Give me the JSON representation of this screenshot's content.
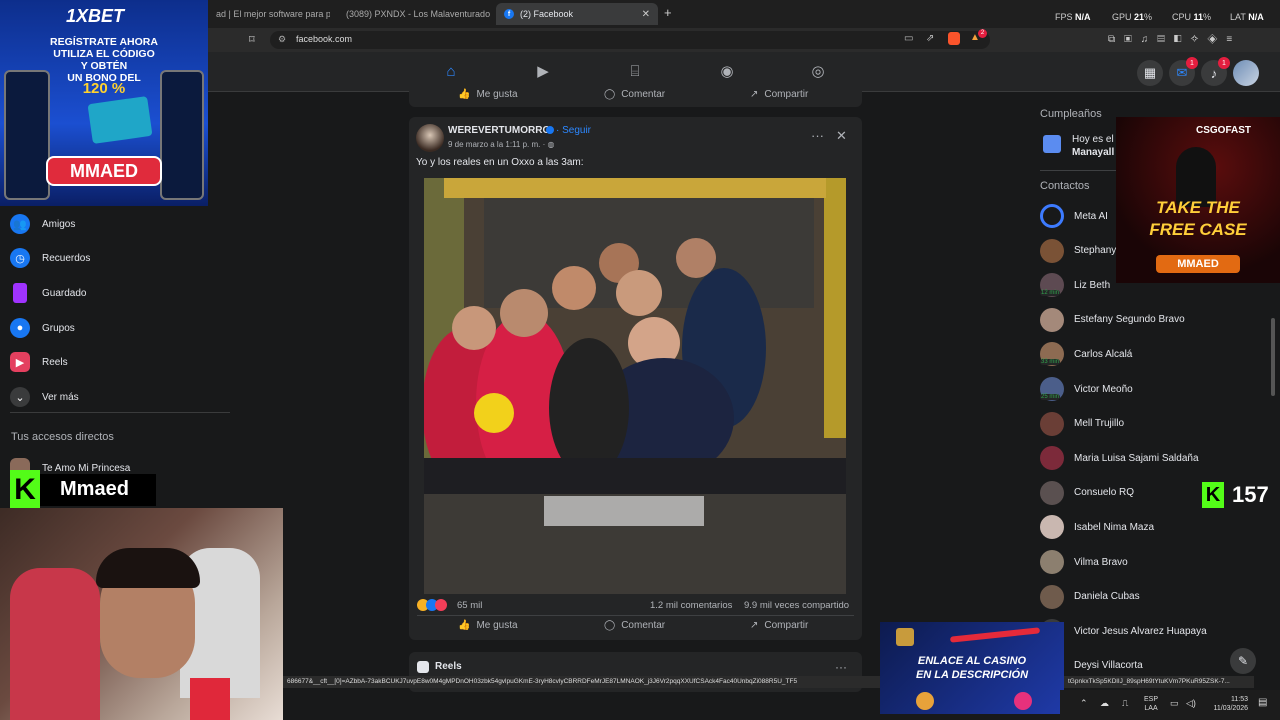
{
  "browser": {
    "tabs": [
      {
        "title": "ad | El mejor software para pote"
      },
      {
        "title": "(3089) PXNDX - Los Malaventurados"
      },
      {
        "title": "(2) Facebook"
      }
    ],
    "new_tab": "+",
    "url": "facebook.com",
    "perf": {
      "fps_label": "FPS",
      "fps": "N/A",
      "gpu_label": "GPU",
      "gpu": "21",
      "gpu_unit": "%",
      "cpu_label": "CPU",
      "cpu": "11",
      "cpu_unit": "%",
      "lat_label": "LAT",
      "lat": "N/A"
    },
    "brave_badge": "2"
  },
  "fb_header": {
    "messenger_badge": "1",
    "notif_badge": "1"
  },
  "left_sidebar": {
    "items": [
      {
        "label": "Amigos",
        "icon": "friends-icon",
        "color": "#1877f2"
      },
      {
        "label": "Recuerdos",
        "icon": "clock-icon",
        "color": "#1877f2"
      },
      {
        "label": "Guardado",
        "icon": "bookmark-icon",
        "color": "#a033ff"
      },
      {
        "label": "Grupos",
        "icon": "groups-icon",
        "color": "#1877f2"
      },
      {
        "label": "Reels",
        "icon": "reels-icon",
        "color": "#e4405f"
      },
      {
        "label": "Ver más",
        "icon": "chevron-down-icon",
        "color": "#3a3b3c"
      }
    ],
    "shortcuts_title": "Tus accesos directos",
    "shortcut": "Te Amo Mi Princesa"
  },
  "feed": {
    "top_actions": {
      "like": "Me gusta",
      "comment": "Comentar",
      "share": "Compartir"
    },
    "post": {
      "author": "WEREVERTUMORRO",
      "follow": "Seguir",
      "date": "9 de marzo a la 1:11 p. m. ·",
      "caption": "Yo y los reales en un Oxxo a las 3am:",
      "reactions": "65 mil",
      "comments": "1.2 mil comentarios",
      "shares": "9.9 mil veces compartido",
      "like": "Me gusta",
      "comment": "Comentar",
      "share": "Compartir"
    },
    "reels_label": "Reels"
  },
  "right_sidebar": {
    "birthdays_title": "Cumpleaños",
    "birthday_text": "Hoy es el",
    "birthday_name": "Manayall",
    "contacts_title": "Contactos",
    "contacts": [
      {
        "name": "Meta AI",
        "color": "#3d7bff",
        "mins": ""
      },
      {
        "name": "Stephany",
        "color": "#7a5236",
        "mins": ""
      },
      {
        "name": "Liz Beth",
        "color": "#5d4a52",
        "mins": "12 min"
      },
      {
        "name": "Estefany Segundo Bravo",
        "color": "#a4897a",
        "mins": ""
      },
      {
        "name": "Carlos Alcalá",
        "color": "#8d6b52",
        "mins": "33 min"
      },
      {
        "name": "Victor Meoño",
        "color": "#4b5e8a",
        "mins": "25 min"
      },
      {
        "name": "Mell Trujillo",
        "color": "#6a3e36",
        "mins": ""
      },
      {
        "name": "Maria Luisa Sajami Saldaña",
        "color": "#7c2a3a",
        "mins": ""
      },
      {
        "name": "Consuelo RQ",
        "color": "#5a5050",
        "mins": ""
      },
      {
        "name": "Isabel Nima Maza",
        "color": "#c9b7b0",
        "mins": ""
      },
      {
        "name": "Vilma Bravo",
        "color": "#8c7f6f",
        "mins": ""
      },
      {
        "name": "Daniela Cubas",
        "color": "#6f5b4c",
        "mins": ""
      },
      {
        "name": "Victor Jesus Alvarez Huapaya",
        "color": "#3a3b3c",
        "mins": ""
      },
      {
        "name": "Deysi Villacorta",
        "color": "#3a3b3c",
        "mins": ""
      }
    ]
  },
  "overlays": {
    "bet_ad": {
      "brand": "1XBET",
      "line1": "REGÍSTRATE AHORA",
      "line2": "UTILIZA EL CÓDIGO",
      "line3": "Y OBTÉN",
      "line4": "UN BONO DEL",
      "percent": "120 %",
      "code": "MMAED"
    },
    "csgo_ad": {
      "brand": "CSGOFAST",
      "line1": "TAKE THE",
      "line2": "FREE CASE",
      "code": "MMAED"
    },
    "kick": {
      "letter": "K",
      "name": "Mmaed",
      "viewers": "157"
    },
    "casino": {
      "line1": "ENLACE AL CASINO",
      "line2": "EN LA DESCRIPCIÓN"
    },
    "status_url": "686677&__cft__[0]=AZbbA-73akBCUKJ7uvpE8w0M4gMPDnOH03zbk54gvlpuGKmE-3ryH8cvlyCBRRDFeMrJE87LMNAOK_j3J6Vr2pqqXXUfCSAck4Fac40UnbqZi088R5U_TF5",
    "status_url_right": "tGpnkxTkSp5KDlIJ_89spH69tYtuKVm7PKuR95ZSK-7...",
    "taskbar": {
      "lang": "ESP",
      "lang2": "LAA",
      "time": "11:53",
      "date": "11/03/2026"
    }
  }
}
